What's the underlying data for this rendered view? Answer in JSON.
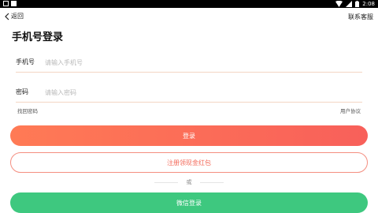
{
  "status_bar": {
    "time": "2:08",
    "icons": [
      "notification-icon",
      "app-icon",
      "wifi-icon",
      "signal-icon",
      "battery-icon"
    ]
  },
  "header": {
    "back_label": "返回",
    "customer_service": "联系客服"
  },
  "page_title": "手机号登录",
  "form": {
    "phone_label": "手机号",
    "phone_placeholder": "请输入手机号",
    "password_label": "密码",
    "password_placeholder": "请输入密码"
  },
  "links": {
    "forgot_password": "找回密码",
    "user_agreement": "用户协议"
  },
  "buttons": {
    "login": "登录",
    "register": "注册领现金红包",
    "wechat_login": "微信登录"
  },
  "divider": {
    "or": "或"
  },
  "colors": {
    "primary": "#f8645a",
    "wechat": "#3ec87f",
    "underline": "#f3d6c4"
  }
}
